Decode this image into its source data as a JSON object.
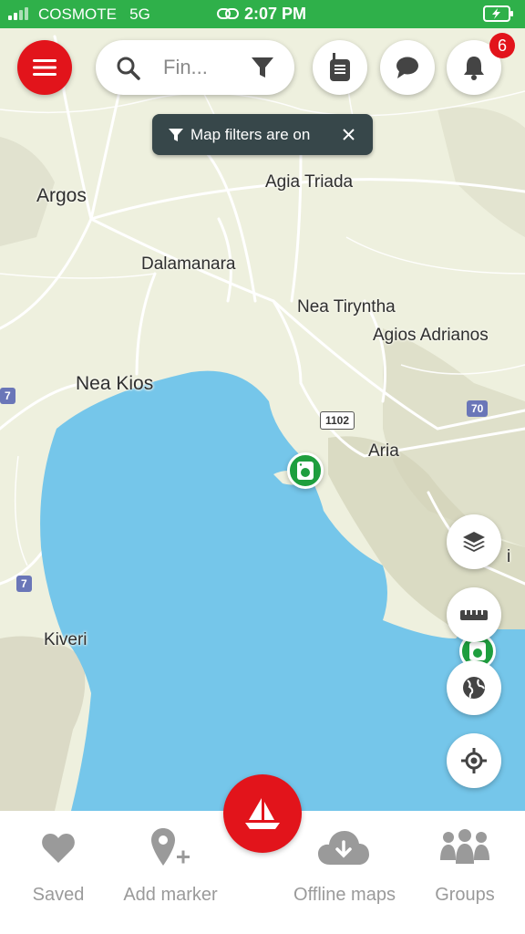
{
  "status_bar": {
    "carrier": "COSMOTE",
    "network": "5G",
    "time": "2:07 PM"
  },
  "search": {
    "placeholder": "Fin..."
  },
  "notifications": {
    "count": "6"
  },
  "filter_banner": {
    "text": "Map filters are on"
  },
  "map": {
    "places": [
      "Argos",
      "Agia Triada",
      "Dalamanara",
      "Nea Tiryntha",
      "Agios Adrianos",
      "Nea Kios",
      "Aria",
      "Kiveri",
      "i"
    ],
    "road_shields": [
      "1102",
      "70",
      "7",
      "7",
      "7"
    ]
  },
  "bottom_nav": [
    {
      "label": "Saved",
      "icon": "heart-icon"
    },
    {
      "label": "Add marker",
      "icon": "add-marker-icon"
    },
    {
      "label": "Offline maps",
      "icon": "cloud-download-icon"
    },
    {
      "label": "Groups",
      "icon": "groups-icon"
    }
  ],
  "colors": {
    "accent_red": "#e2141b",
    "status_green": "#2fb04a",
    "water": "#75c6ea",
    "marker_green": "#1e9e3e"
  }
}
